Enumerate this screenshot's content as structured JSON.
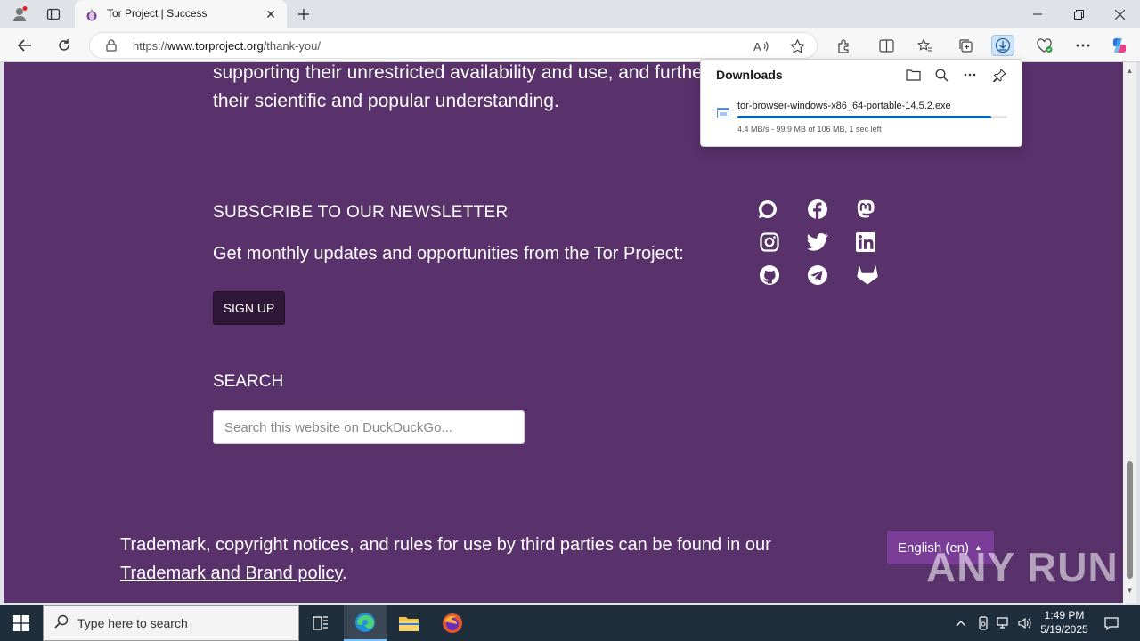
{
  "browser": {
    "tab_title": "Tor Project | Success",
    "url_prefix": "https://",
    "url_host": "www.torproject.org",
    "url_path": "/thank-you/"
  },
  "page": {
    "intro_line1": "supporting their unrestricted availability and use, and furthering",
    "intro_line2": "their scientific and popular understanding.",
    "newsletter_heading": "SUBSCRIBE TO OUR NEWSLETTER",
    "newsletter_text": "Get monthly updates and opportunities from the Tor Project:",
    "signup_label": "SIGN UP",
    "search_heading": "SEARCH",
    "search_placeholder": "Search this website on DuckDuckGo...",
    "trademark_text": "Trademark, copyright notices, and rules for use by third parties can be found in our",
    "trademark_link": "Trademark and Brand policy",
    "trademark_end": ".",
    "language_label": "English (en)",
    "social_icons": [
      "chat-icon",
      "facebook-icon",
      "mastodon-icon",
      "instagram-icon",
      "twitter-icon",
      "linkedin-icon",
      "github-icon",
      "telegram-icon",
      "gitlab-icon"
    ]
  },
  "downloads": {
    "title": "Downloads",
    "file_name": "tor-browser-windows-x86_64-portable-14.5.2.exe",
    "status": "4.4 MB/s - 99.9 MB of 106 MB, 1 sec left",
    "progress": 0.942
  },
  "watermark": "ANY RUN",
  "taskbar": {
    "search_placeholder": "Type here to search",
    "time": "1:49 PM",
    "date": "5/19/2025"
  },
  "colors": {
    "page_bg": "#59316b",
    "signup_bg": "#2f1837",
    "language_bg": "#7a3d98",
    "accent": "#0067c0"
  }
}
